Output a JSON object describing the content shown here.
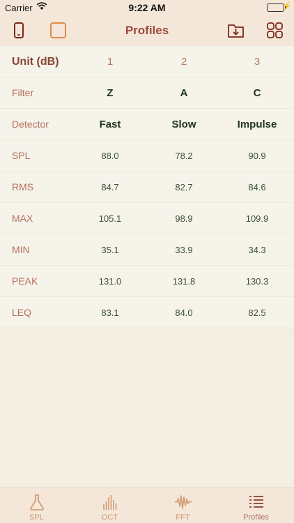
{
  "status": {
    "carrier": "Carrier",
    "time": "9:22 AM"
  },
  "nav": {
    "title": "Profiles"
  },
  "table": {
    "header": {
      "label": "Unit (dB)",
      "cols": [
        "1",
        "2",
        "3"
      ]
    },
    "rows": [
      {
        "label": "Filter",
        "values": [
          "Z",
          "A",
          "C"
        ]
      },
      {
        "label": "Detector",
        "values": [
          "Fast",
          "Slow",
          "Impulse"
        ]
      },
      {
        "label": "SPL",
        "values": [
          "88.0",
          "78.2",
          "90.9"
        ]
      },
      {
        "label": "RMS",
        "values": [
          "84.7",
          "82.7",
          "84.6"
        ]
      },
      {
        "label": "MAX",
        "values": [
          "105.1",
          "98.9",
          "109.9"
        ]
      },
      {
        "label": "MIN",
        "values": [
          "35.1",
          "33.9",
          "34.3"
        ]
      },
      {
        "label": "PEAK",
        "values": [
          "131.0",
          "131.8",
          "130.3"
        ]
      },
      {
        "label": "LEQ",
        "values": [
          "83.1",
          "84.0",
          "82.5"
        ]
      }
    ]
  },
  "tabs": [
    {
      "label": "SPL",
      "icon": "flask-icon"
    },
    {
      "label": "OCT",
      "icon": "octave-bars-icon"
    },
    {
      "label": "FFT",
      "icon": "waveform-icon"
    },
    {
      "label": "Profiles",
      "icon": "list-icon"
    }
  ],
  "colors": {
    "accent": "#9b4a3a",
    "nav_bg": "#f4e6d8",
    "highlight_orange": "#e08a4a"
  }
}
